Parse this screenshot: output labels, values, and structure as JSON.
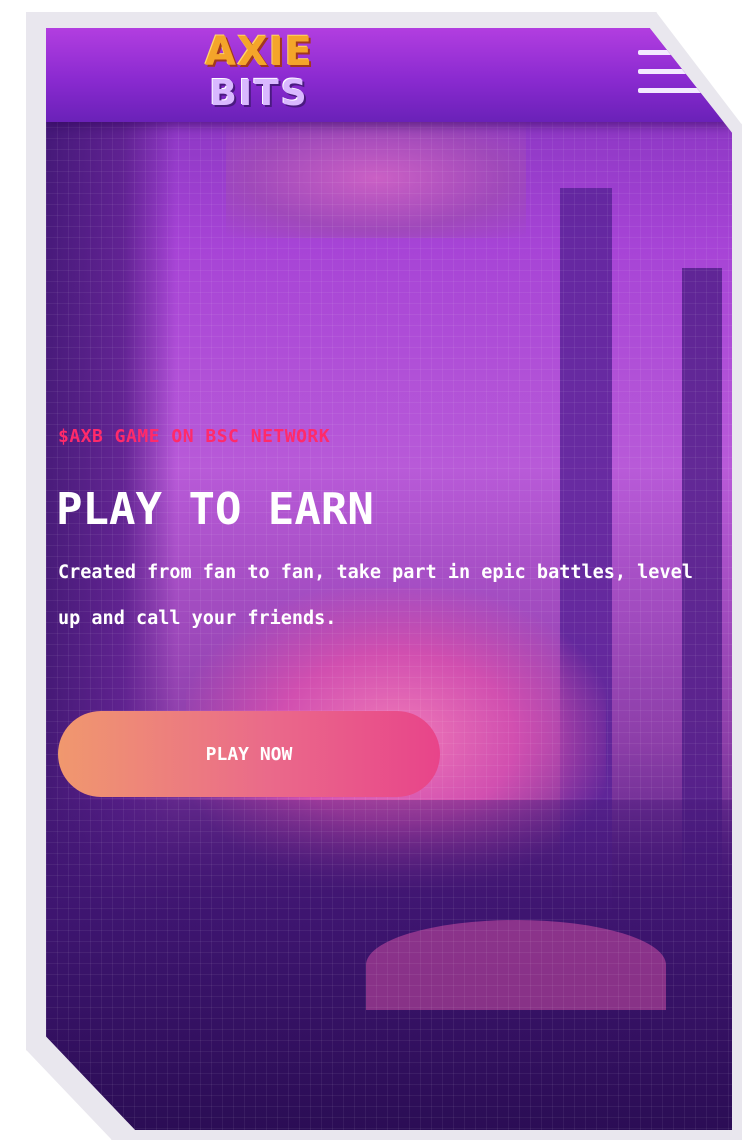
{
  "header": {
    "logo_top": "AXIE",
    "logo_bottom": "BITS",
    "menu_icon": "hamburger-menu-icon"
  },
  "hero": {
    "tagline": "$AXB GAME ON BSC NETWORK",
    "headline": "PLAY TO EARN",
    "description": "Created from fan to fan, take part in epic battles, level up and call your friends.",
    "cta_label": "PLAY NOW"
  },
  "colors": {
    "accent_pink": "#ff2a6a",
    "header_purple": "#8a2ad0",
    "cta_gradient_start": "#f0986e",
    "cta_gradient_end": "#e8448a"
  }
}
